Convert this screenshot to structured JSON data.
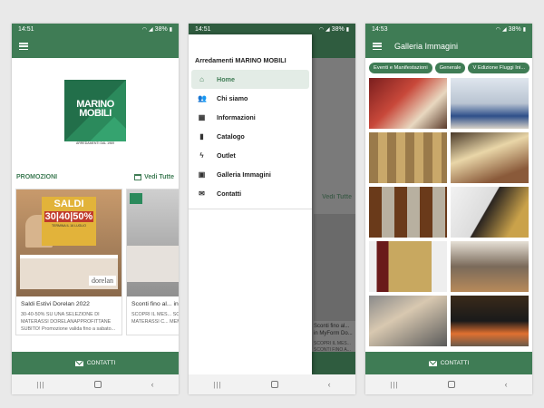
{
  "status": {
    "p1": {
      "time": "14:51",
      "battery": "38%"
    },
    "p2": {
      "time": "14:51",
      "battery": "38%"
    },
    "p3": {
      "time": "14:53",
      "battery": "38%"
    }
  },
  "home": {
    "logo": {
      "line1": "MARINO",
      "line2": "MOBILI",
      "tagline": "ARREDAMENTI DAL 1969"
    },
    "promo_title": "PROMOZIONI",
    "see_all": "Vedi Tutte",
    "cards": [
      {
        "title": "Saldi Estivi Dorelan 2022",
        "desc": "30-40-50% SU UNA SELEZIONE DI MATERASSI DORELANAPPROFITTANE SUBITO! Promozione valida fino a sabato...",
        "banner_title": "SALDI",
        "banner_pct": "30|40|50%",
        "banner_date": "TERMINA IL 16 LUGLIO",
        "brand": "dorelan"
      },
      {
        "title": "Sconti fino al... in MyForm Do...",
        "desc": "SCOPRI IL MES... SCONTI FINO A... MATERASSI C... MEMORIA GUN..."
      }
    ],
    "contact_label": "CONTATTI"
  },
  "drawer": {
    "header": "Arredamenti MARINO MOBILI",
    "items": [
      {
        "label": "Home",
        "icon": "home-icon"
      },
      {
        "label": "Chi siamo",
        "icon": "people-icon"
      },
      {
        "label": "Informazioni",
        "icon": "grid-icon"
      },
      {
        "label": "Catalogo",
        "icon": "book-icon"
      },
      {
        "label": "Outlet",
        "icon": "bolt-icon"
      },
      {
        "label": "Galleria Immagini",
        "icon": "gallery-icon"
      },
      {
        "label": "Contatti",
        "icon": "mail-icon"
      }
    ],
    "ghost_vedi": "Vedi Tutte",
    "ghost_card_title": "Sconti fino al... in MyForm Do...",
    "ghost_card_desc": "SCOPRI IL MES... SCONTI FINO A... MATERASSI C... MEMORIA GUN..."
  },
  "gallery": {
    "title": "Galleria Immagini",
    "chips": [
      "Eventi e Manifestazioni",
      "Generale",
      "V Edizione Fluggi Ini..."
    ],
    "images": [
      "painting-red",
      "sofa-blue",
      "bookshelf-wood",
      "wood-cabinet-lamp",
      "glass-cabinet",
      "decor-vase",
      "framed-art",
      "wood-units",
      "fabric-swatches",
      "kitchen-stove"
    ],
    "contact_label": "CONTATTI"
  }
}
